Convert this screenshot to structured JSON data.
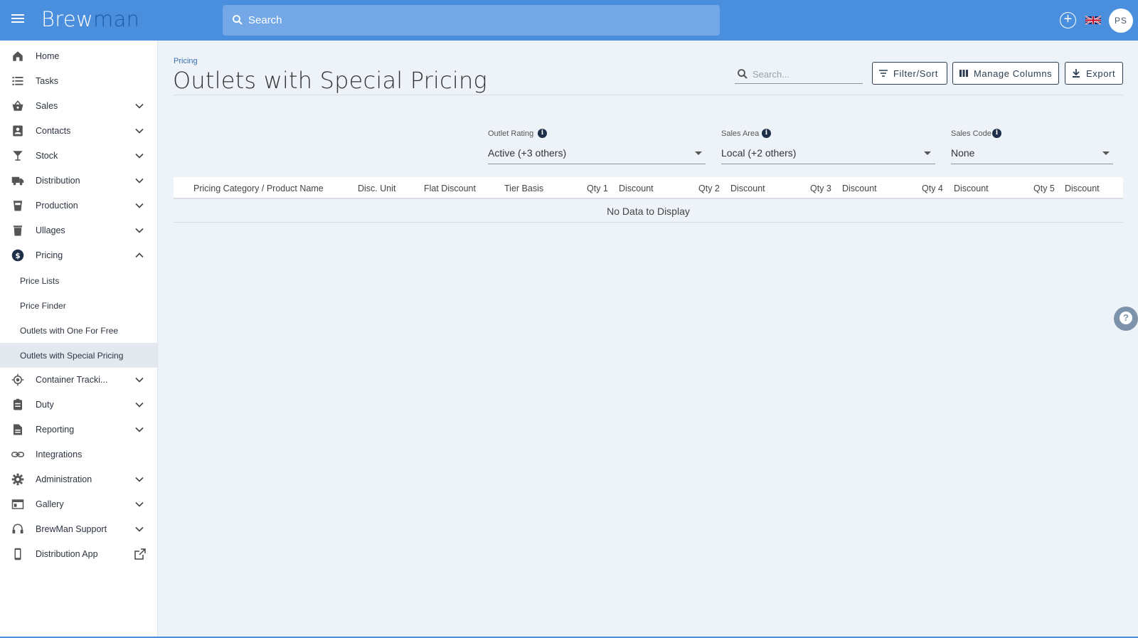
{
  "app": {
    "logo_part1": "Brew",
    "logo_part2": "man",
    "search_placeholder": "Search",
    "user_initials": "PS",
    "brand_color": "#4a8fde"
  },
  "sidebar": {
    "items": [
      {
        "label": "Home",
        "icon": "home-icon",
        "chevron": false
      },
      {
        "label": "Tasks",
        "icon": "list-icon",
        "chevron": false
      },
      {
        "label": "Sales",
        "icon": "basket-icon",
        "chevron": "down"
      },
      {
        "label": "Contacts",
        "icon": "contacts-icon",
        "chevron": "down"
      },
      {
        "label": "Stock",
        "icon": "glass-icon",
        "chevron": "down"
      },
      {
        "label": "Distribution",
        "icon": "truck-icon",
        "chevron": "down"
      },
      {
        "label": "Production",
        "icon": "cup-icon",
        "chevron": "down"
      },
      {
        "label": "Ullages",
        "icon": "trash-icon",
        "chevron": "down"
      },
      {
        "label": "Pricing",
        "icon": "dollar-icon",
        "chevron": "up"
      },
      {
        "label": "Container Tracki...",
        "icon": "target-icon",
        "chevron": "down"
      },
      {
        "label": "Duty",
        "icon": "clipboard-icon",
        "chevron": "down"
      },
      {
        "label": "Reporting",
        "icon": "document-icon",
        "chevron": "down"
      },
      {
        "label": "Integrations",
        "icon": "link-icon",
        "chevron": false
      },
      {
        "label": "Administration",
        "icon": "gear-icon",
        "chevron": "down"
      },
      {
        "label": "Gallery",
        "icon": "gallery-icon",
        "chevron": "down"
      },
      {
        "label": "BrewMan Support",
        "icon": "headset-icon",
        "chevron": "down"
      },
      {
        "label": "Distribution App",
        "icon": "phone-icon",
        "chevron": "external"
      }
    ],
    "pricing_sub": [
      {
        "label": "Price Lists"
      },
      {
        "label": "Price Finder"
      },
      {
        "label": "Outlets with One For Free"
      },
      {
        "label": "Outlets with Special Pricing",
        "active": true
      }
    ]
  },
  "page": {
    "breadcrumb": "Pricing",
    "title": "Outlets with Special Pricing",
    "search_placeholder": "Search...",
    "buttons": {
      "filter_sort": "Filter/Sort",
      "manage_columns": "Manage Columns",
      "export": "Export"
    }
  },
  "filters": [
    {
      "label": "Outlet Rating",
      "value": "Active (+3 others)"
    },
    {
      "label": "Sales Area",
      "value": "Local (+2 others)"
    },
    {
      "label": "Sales Code",
      "value": "None"
    }
  ],
  "table": {
    "columns": [
      "Pricing Category / Product Name",
      "Disc. Unit",
      "Flat Discount",
      "Tier Basis",
      "Qty 1",
      "Discount",
      "Qty 2",
      "Discount",
      "Qty 3",
      "Discount",
      "Qty 4",
      "Discount",
      "Qty 5",
      "Discount"
    ],
    "empty_message": "No Data to Display"
  }
}
